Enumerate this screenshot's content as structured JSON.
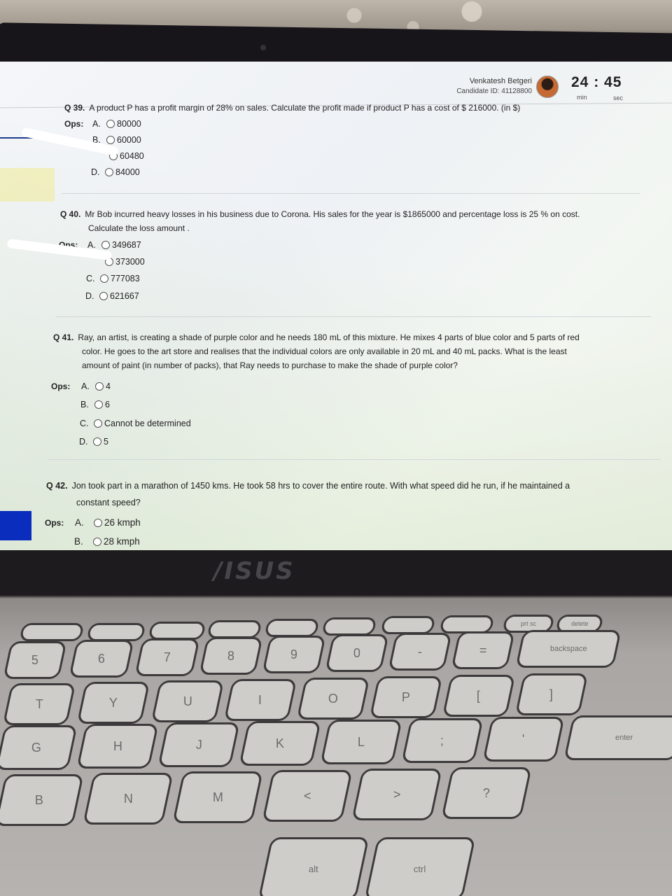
{
  "header": {
    "candidate_name": "Venkatesh Betgeri",
    "candidate_id": "Candidate ID: 41128800",
    "timer": "24 : 45",
    "timer_min_label": "min",
    "timer_sec_label": "sec"
  },
  "ops_label": "Ops:",
  "questions": [
    {
      "number": "Q 39.",
      "text": "A product P has a profit margin of 28% on sales. Calculate the profit made if product P has a cost of $ 216000. (in $)",
      "options": [
        {
          "letter": "A.",
          "value": "80000"
        },
        {
          "letter": "B.",
          "value": "60000"
        },
        {
          "letter": "",
          "value": "60480"
        },
        {
          "letter": "D.",
          "value": "84000"
        }
      ]
    },
    {
      "number": "Q 40.",
      "text": "Mr Bob incurred heavy losses in his business due to Corona. His sales for the year is $1865000 and percentage loss is 25 % on cost.",
      "text2": "Calculate the loss amount .",
      "options": [
        {
          "letter": "A.",
          "value": "349687"
        },
        {
          "letter": "",
          "value": "373000"
        },
        {
          "letter": "C.",
          "value": "777083"
        },
        {
          "letter": "D.",
          "value": "621667"
        }
      ]
    },
    {
      "number": "Q 41.",
      "text": "Ray, an artist, is creating a shade of purple color and he needs 180 mL of this mixture. He mixes 4 parts of blue color and 5 parts of red",
      "text2": "color. He goes to the art store and realises that the individual colors are only available in 20 mL and 40 mL packs. What is the least",
      "text3": "amount of paint (in number of packs), that Ray needs to purchase to make the shade of purple color?",
      "options": [
        {
          "letter": "A.",
          "value": "4"
        },
        {
          "letter": "B.",
          "value": "6"
        },
        {
          "letter": "C.",
          "value": "Cannot be determined"
        },
        {
          "letter": "D.",
          "value": "5"
        }
      ]
    },
    {
      "number": "Q 42.",
      "text": "Jon took part in a marathon of 1450 kms. He took 58 hrs to cover the entire route. With what speed did he run, if he maintained a",
      "text2": "constant speed?",
      "options": [
        {
          "letter": "A.",
          "value": "26 kmph"
        },
        {
          "letter": "B.",
          "value": "28 kmph"
        }
      ]
    }
  ],
  "laptop": {
    "brand": "/ISUS",
    "keys": {
      "r1": [
        "5",
        "6",
        "7",
        "8",
        "9",
        "0",
        "-",
        "=",
        "backspace"
      ],
      "r2": [
        "T",
        "Y",
        "U",
        "I",
        "O",
        "P",
        "[",
        "]"
      ],
      "r3": [
        "G",
        "H",
        "J",
        "K",
        "L",
        ";",
        "'",
        "enter"
      ],
      "r4": [
        "B",
        "N",
        "M",
        "<",
        ">",
        "?"
      ],
      "bottom": [
        "alt",
        "ctrl"
      ],
      "fn": [
        "prt sc",
        "delete"
      ]
    }
  }
}
